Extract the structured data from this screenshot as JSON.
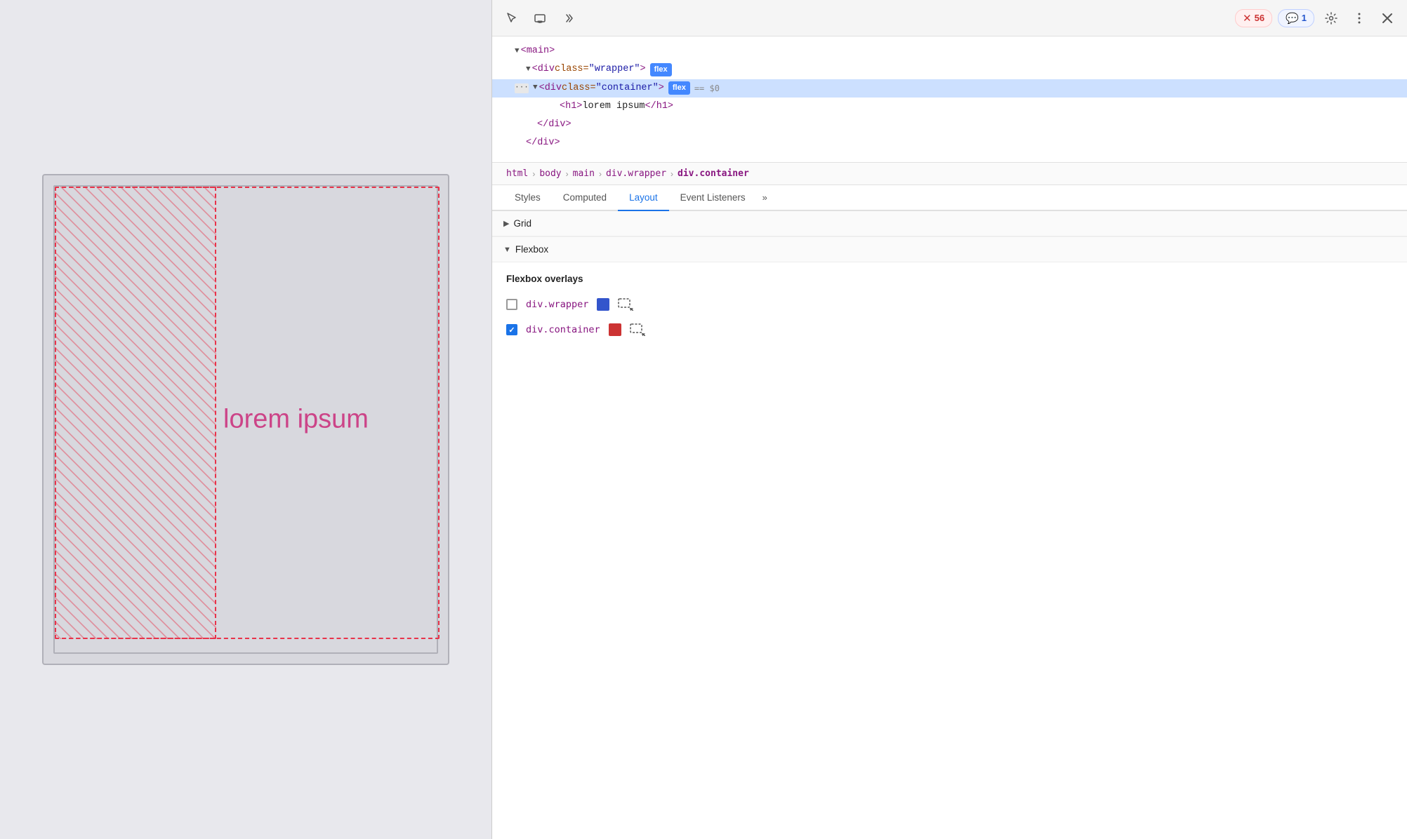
{
  "toolbar": {
    "errors_count": "56",
    "messages_count": "1",
    "inspect_icon": "cursor",
    "device_icon": "device",
    "more_tools_icon": "chevron-right"
  },
  "dom_tree": {
    "lines": [
      {
        "indent": 0,
        "content": "<main>",
        "expanded": true
      },
      {
        "indent": 1,
        "content": "<div class=\"wrapper\">",
        "expanded": true,
        "badge": "flex"
      },
      {
        "indent": 2,
        "content": "<div class=\"container\">",
        "expanded": true,
        "badge": "flex",
        "dollar_zero": "== $0",
        "selected": true,
        "has_more": true
      },
      {
        "indent": 3,
        "content": "<h1>lorem ipsum</h1>"
      },
      {
        "indent": 2,
        "content": "</div>"
      },
      {
        "indent": 1,
        "content": "</div>"
      }
    ]
  },
  "breadcrumb": {
    "items": [
      "html",
      "body",
      "main",
      "div.wrapper",
      "div.container"
    ]
  },
  "tabs": {
    "items": [
      "Styles",
      "Computed",
      "Layout",
      "Event Listeners"
    ],
    "active": "Layout"
  },
  "layout": {
    "grid_section": "Grid",
    "flexbox_section": "Flexbox",
    "flexbox_overlays_title": "Flexbox overlays",
    "overlays": [
      {
        "id": "wrapper",
        "label": "div.wrapper",
        "checked": false,
        "color": "#3355cc"
      },
      {
        "id": "container",
        "label": "div.container",
        "checked": true,
        "color": "#cc3333"
      }
    ]
  },
  "preview": {
    "lorem_text": "lorem ipsum"
  }
}
